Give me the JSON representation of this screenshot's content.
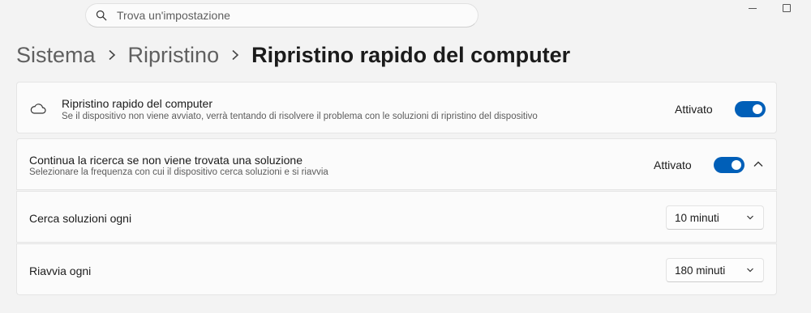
{
  "search": {
    "placeholder": "Trova un'impostazione",
    "icon": "search-icon"
  },
  "breadcrumb": {
    "items": [
      "Sistema",
      "Ripristino",
      "Ripristino rapido del computer"
    ]
  },
  "settings": [
    {
      "title": "Ripristino rapido del computer",
      "description": "Se il dispositivo non viene avviato, verrà tentando di risolvere il problema con le soluzioni di ripristino del dispositivo",
      "state": "Attivato",
      "toggle_on": true,
      "icon": "cloud-icon"
    },
    {
      "title": "Continua la ricerca se non viene trovata una soluzione",
      "description": "Selezionare la frequenza con cui il dispositivo cerca soluzioni e si riavvia",
      "state": "Attivato",
      "toggle_on": true,
      "expanded": true
    },
    {
      "title": "Cerca soluzioni ogni",
      "selected": "10 minuti"
    },
    {
      "title": "Riavvia ogni",
      "selected": "180 minuti"
    }
  ],
  "colors": {
    "accent": "#005fb8",
    "background": "#f3f3f3",
    "card": "#fbfbfb"
  }
}
